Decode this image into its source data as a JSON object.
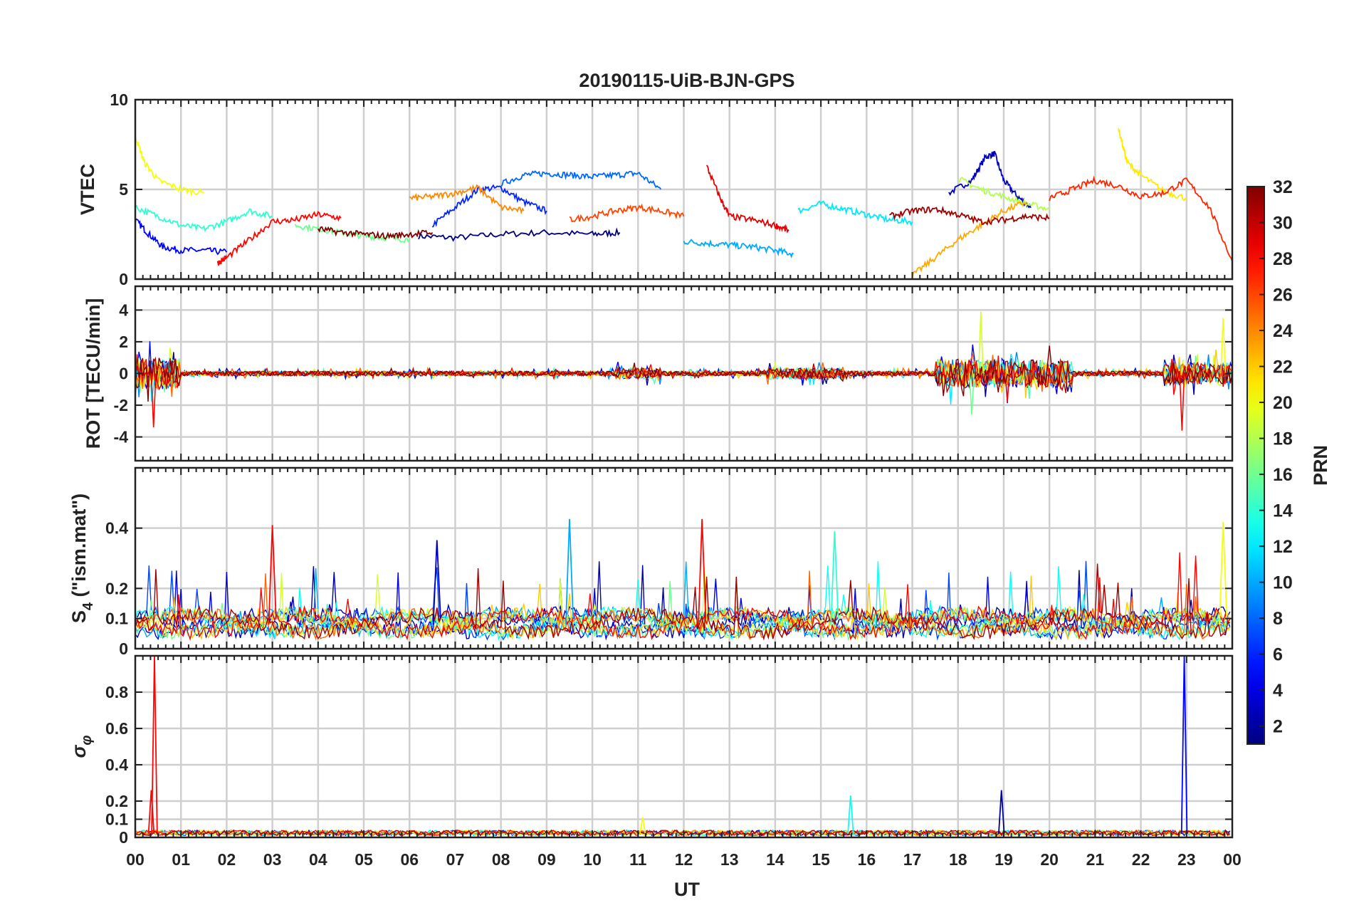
{
  "figure": {
    "title": "20190115-UiB-BJN-GPS",
    "xlabel": "UT"
  },
  "chart_data": [
    {
      "type": "line",
      "panel": "vtec",
      "ylabel": "VTEC",
      "ylim": [
        0,
        10
      ],
      "yticks": [
        0,
        5,
        10
      ],
      "xlim": [
        0,
        24
      ],
      "grid": true,
      "series": [
        {
          "prn": 1,
          "x": [
            6.2,
            7.0,
            8.0,
            9.0,
            10.0,
            10.6
          ],
          "y": [
            2.4,
            2.3,
            2.5,
            2.6,
            2.5,
            2.6
          ]
        },
        {
          "prn": 3,
          "x": [
            17.8,
            18.3,
            18.6,
            18.8,
            19.0,
            19.3,
            19.6
          ],
          "y": [
            4.8,
            5.5,
            6.8,
            7.0,
            5.5,
            4.6,
            4.0
          ]
        },
        {
          "prn": 5,
          "x": [
            0.0,
            0.3,
            0.6,
            1.0,
            1.5,
            2.0
          ],
          "y": [
            3.3,
            2.5,
            1.8,
            1.6,
            1.6,
            1.5
          ]
        },
        {
          "prn": 6,
          "x": [
            6.5,
            7.0,
            7.5,
            8.0,
            8.5,
            9.0
          ],
          "y": [
            3.0,
            4.0,
            5.0,
            5.1,
            4.3,
            3.8
          ]
        },
        {
          "prn": 8,
          "x": [
            8.0,
            8.5,
            9.0,
            9.5,
            10.0,
            10.5,
            11.0,
            11.5
          ],
          "y": [
            5.3,
            5.8,
            5.9,
            5.8,
            5.7,
            5.8,
            5.9,
            5.0
          ]
        },
        {
          "prn": 10,
          "x": [
            12.0,
            12.5,
            13.0,
            13.5,
            14.0,
            14.4
          ],
          "y": [
            2.1,
            2.0,
            1.9,
            1.8,
            1.6,
            1.4
          ]
        },
        {
          "prn": 12,
          "x": [
            14.5,
            15.0,
            15.5,
            16.0,
            16.5,
            17.0
          ],
          "y": [
            3.8,
            4.2,
            3.9,
            3.6,
            3.3,
            3.2
          ]
        },
        {
          "prn": 14,
          "x": [
            0.0,
            0.5,
            1.0,
            1.5,
            2.0,
            2.5,
            3.0
          ],
          "y": [
            4.0,
            3.5,
            3.0,
            2.8,
            3.2,
            3.8,
            3.5
          ]
        },
        {
          "prn": 16,
          "x": [
            3.5,
            4.0,
            4.5,
            5.0,
            5.5,
            6.0
          ],
          "y": [
            3.0,
            2.8,
            2.6,
            2.4,
            2.3,
            2.2
          ]
        },
        {
          "prn": 18,
          "x": [
            18.0,
            18.5,
            19.0,
            19.5,
            20.0
          ],
          "y": [
            5.6,
            5.0,
            4.6,
            4.2,
            3.9
          ]
        },
        {
          "prn": 20,
          "x": [
            0.0,
            0.2,
            0.5,
            1.0,
            1.5
          ],
          "y": [
            8.0,
            6.5,
            5.5,
            5.0,
            4.8
          ]
        },
        {
          "prn": 21,
          "x": [
            21.5,
            21.7,
            22.0,
            22.5,
            23.0
          ],
          "y": [
            8.5,
            6.5,
            5.8,
            4.9,
            4.5
          ]
        },
        {
          "prn": 23,
          "x": [
            17.0,
            17.5,
            18.0,
            18.5,
            19.0,
            19.5
          ],
          "y": [
            0.2,
            1.2,
            2.2,
            3.0,
            3.8,
            4.3
          ]
        },
        {
          "prn": 24,
          "x": [
            6.0,
            6.5,
            7.0,
            7.5,
            8.0,
            8.5
          ],
          "y": [
            4.5,
            4.6,
            4.8,
            5.1,
            4.0,
            3.8
          ]
        },
        {
          "prn": 26,
          "x": [
            9.5,
            10.0,
            10.5,
            11.0,
            11.5,
            12.0
          ],
          "y": [
            3.3,
            3.5,
            3.8,
            4.0,
            3.8,
            3.5
          ]
        },
        {
          "prn": 27,
          "x": [
            20.0,
            20.5,
            21.0,
            21.5,
            22.0,
            22.5,
            23.0,
            23.5,
            24.0
          ],
          "y": [
            4.5,
            5.0,
            5.5,
            5.2,
            4.6,
            4.8,
            5.5,
            4.0,
            1.0
          ]
        },
        {
          "prn": 28,
          "x": [
            1.8,
            2.0,
            2.5,
            3.0,
            3.5,
            4.0,
            4.5
          ],
          "y": [
            0.9,
            1.2,
            2.2,
            3.2,
            3.3,
            3.6,
            3.4
          ]
        },
        {
          "prn": 29,
          "x": [
            12.5,
            12.8,
            13.0,
            13.5,
            14.0,
            14.3
          ],
          "y": [
            6.3,
            4.5,
            3.5,
            3.3,
            3.0,
            2.7
          ]
        },
        {
          "prn": 31,
          "x": [
            16.5,
            17.0,
            17.5,
            18.0,
            18.5,
            19.0,
            19.5,
            20.0
          ],
          "y": [
            3.5,
            3.8,
            3.9,
            3.6,
            3.2,
            3.3,
            3.5,
            3.4
          ]
        },
        {
          "prn": 32,
          "x": [
            4.0,
            4.5,
            5.0,
            5.5,
            6.0,
            6.5
          ],
          "y": [
            2.8,
            2.6,
            2.5,
            2.4,
            2.5,
            2.6
          ]
        }
      ]
    },
    {
      "type": "line",
      "panel": "rot",
      "ylabel": "ROT [TECU/min]",
      "ylim": [
        -5.5,
        5.5
      ],
      "yticks": [
        -4,
        -2,
        0,
        2,
        4
      ],
      "xlim": [
        0,
        24
      ],
      "grid": true,
      "note_spikes": [
        {
          "x": 0.4,
          "y": -3.4
        },
        {
          "x": 18.5,
          "y": 3.9
        },
        {
          "x": 22.9,
          "y": -3.6
        },
        {
          "x": 23.8,
          "y": 3.5
        },
        {
          "x": 18.3,
          "y": -2.6
        }
      ]
    },
    {
      "type": "line",
      "panel": "s4",
      "ylabel": "S4 (\"ism.mat\")",
      "ylim": [
        0,
        0.6
      ],
      "yticks": [
        0,
        0.1,
        0.2,
        0.4
      ],
      "xlim": [
        0,
        24
      ],
      "grid": true,
      "peaks": [
        {
          "x": 3.0,
          "y": 0.41
        },
        {
          "x": 9.5,
          "y": 0.43
        },
        {
          "x": 12.4,
          "y": 0.43
        },
        {
          "x": 15.3,
          "y": 0.39
        },
        {
          "x": 6.6,
          "y": 0.36
        },
        {
          "x": 23.8,
          "y": 0.42
        }
      ]
    },
    {
      "type": "line",
      "panel": "sigma_phi",
      "ylabel": "σφ",
      "ylim": [
        0,
        1
      ],
      "yticks": [
        0,
        0.1,
        0.2,
        0.4,
        0.6,
        0.8
      ],
      "xlim": [
        0,
        24
      ],
      "grid": true,
      "peaks": [
        {
          "x": 0.42,
          "y": 1.0
        },
        {
          "x": 22.95,
          "y": 1.0
        },
        {
          "x": 0.35,
          "y": 0.26
        },
        {
          "x": 15.65,
          "y": 0.23
        },
        {
          "x": 18.95,
          "y": 0.26
        },
        {
          "x": 11.1,
          "y": 0.11
        }
      ]
    }
  ],
  "xaxis": {
    "ticks": [
      "00",
      "01",
      "02",
      "03",
      "04",
      "05",
      "06",
      "07",
      "08",
      "09",
      "10",
      "11",
      "12",
      "13",
      "14",
      "15",
      "16",
      "17",
      "18",
      "19",
      "20",
      "21",
      "22",
      "23",
      "00"
    ]
  },
  "colorbar": {
    "label": "PRN",
    "range": [
      1,
      32
    ],
    "ticks": [
      "2",
      "4",
      "6",
      "8",
      "10",
      "12",
      "14",
      "16",
      "18",
      "20",
      "22",
      "24",
      "26",
      "28",
      "30",
      "32"
    ],
    "colormap": "jet"
  }
}
